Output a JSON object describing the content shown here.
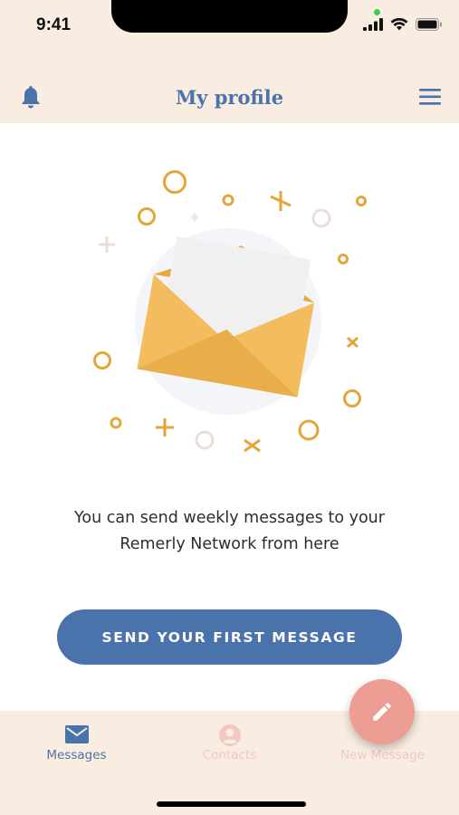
{
  "status_bar": {
    "time": "9:41"
  },
  "header": {
    "title": "My profile",
    "left_icon": "bell-icon",
    "right_icon": "menu-icon"
  },
  "illustration": {
    "icon": "open-envelope-icon",
    "colors": {
      "envelope": "#f0b95a",
      "letter": "#efefef",
      "confetti": "#e5a53b"
    }
  },
  "main": {
    "message_line1": "You can send weekly messages to your",
    "message_line2": "Remerly Network from here",
    "cta_label": "SEND YOUR FIRST MESSAGE"
  },
  "tabs": [
    {
      "label": "Messages",
      "icon": "mail-icon",
      "active": true
    },
    {
      "label": "Contacts",
      "icon": "account-icon",
      "active": false
    },
    {
      "label": "New Message",
      "icon": "pencil-icon",
      "active": false
    }
  ],
  "colors": {
    "primary": "#4a73ab",
    "header_bg": "#f9ece1",
    "fab": "#ee9d95",
    "inactive_tab": "#f2c7c2"
  }
}
